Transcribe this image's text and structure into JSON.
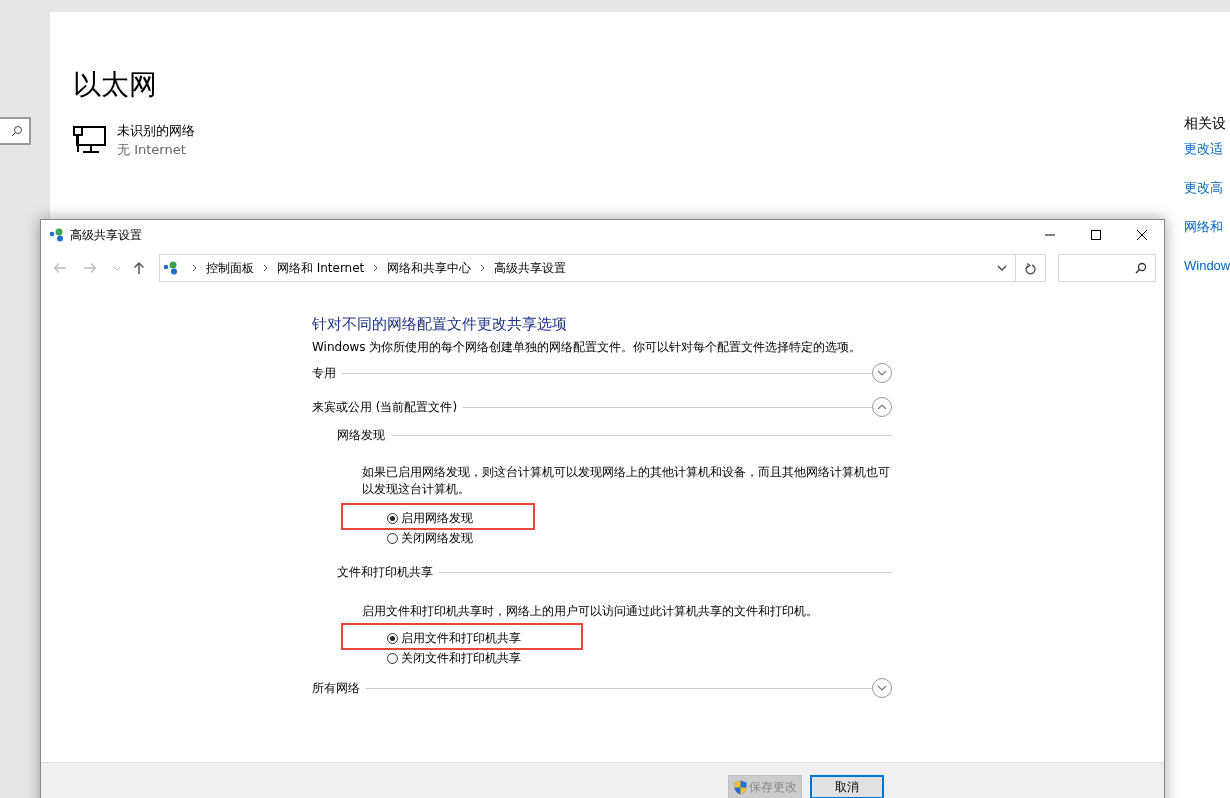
{
  "background_window": {
    "title": "以太网",
    "network": {
      "name": "未识别的网络",
      "status": "无 Internet"
    },
    "related_settings": {
      "heading": "相关设",
      "links": [
        "更改适",
        "更改高",
        "网络和",
        "Window"
      ]
    }
  },
  "dialog": {
    "title": "高级共享设置",
    "breadcrumb": [
      "控制面板",
      "网络和 Internet",
      "网络和共享中心",
      "高级共享设置"
    ],
    "heading": "针对不同的网络配置文件更改共享选项",
    "intro": "Windows 为你所使用的每个网络创建单独的网络配置文件。你可以针对每个配置文件选择特定的选项。",
    "profiles": [
      {
        "label": "专用",
        "expanded": false
      },
      {
        "label": "来宾或公用 (当前配置文件)",
        "expanded": true,
        "groups": [
          {
            "title": "网络发现",
            "description": "如果已启用网络发现，则这台计算机可以发现网络上的其他计算机和设备，而且其他网络计算机也可以发现这台计算机。",
            "options": [
              {
                "label": "启用网络发现",
                "selected": true,
                "highlighted": true
              },
              {
                "label": "关闭网络发现",
                "selected": false,
                "highlighted": false
              }
            ]
          },
          {
            "title": "文件和打印机共享",
            "description": "启用文件和打印机共享时，网络上的用户可以访问通过此计算机共享的文件和打印机。",
            "options": [
              {
                "label": "启用文件和打印机共享",
                "selected": true,
                "highlighted": true
              },
              {
                "label": "关闭文件和打印机共享",
                "selected": false,
                "highlighted": false
              }
            ]
          }
        ]
      },
      {
        "label": "所有网络",
        "expanded": false
      }
    ],
    "buttons": [
      {
        "label": "保存更改",
        "kind": "admin",
        "disabled": true
      },
      {
        "label": "取消",
        "kind": "plain",
        "disabled": false
      }
    ]
  }
}
